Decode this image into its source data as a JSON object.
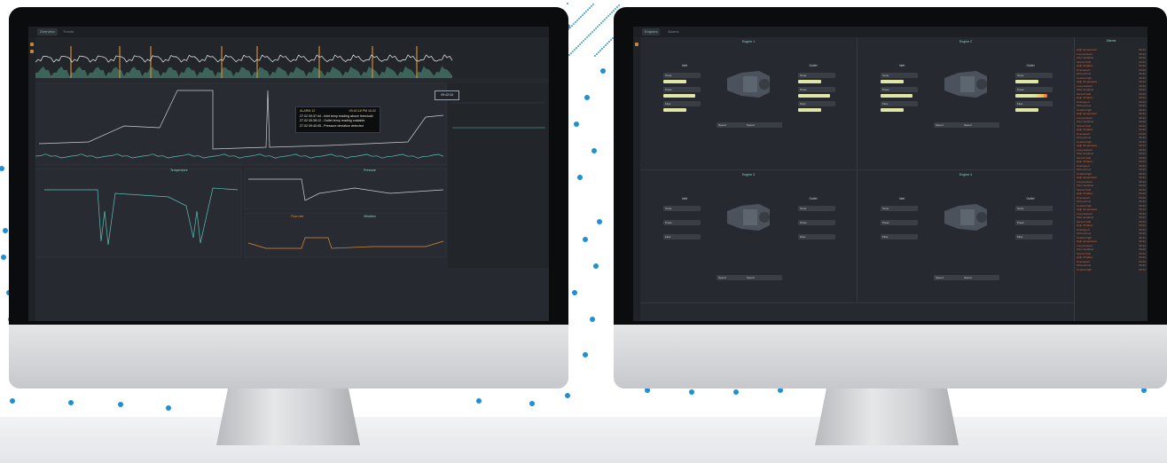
{
  "left_monitor": {
    "tabs": [
      "Overview",
      "Trends"
    ],
    "popup": {
      "title": "ALARM 12",
      "time": "09:42:18 PM 16.02",
      "lines": [
        "27.02 09:37:44 - Inlet temp reading above threshold",
        "27.02 09:38:12 - Outlet temp reading unstable",
        "27.02 09:40:05 - Pressure deviation detected"
      ]
    },
    "cursor_readout": "09:42:18",
    "panel_labels": [
      "Temperature",
      "Pressure",
      "Flow rate",
      "Vibration"
    ]
  },
  "right_monitor": {
    "tabs": [
      "Engines",
      "Alarms"
    ],
    "quad_titles": [
      "Engine 1",
      "Engine 2",
      "Engine 3",
      "Engine 4"
    ],
    "sub_titles": [
      "Inlet",
      "Outlet",
      "Inlet",
      "Outlet"
    ],
    "fields": [
      "Temp",
      "Press",
      "Flow",
      "Speed"
    ],
    "alarm_header": "Alarms",
    "alarms": [
      "High temperature",
      "Low pressure",
      "Flow deviation",
      "Sensor fault",
      "High vibration",
      "Overspeed",
      "Oil level low",
      "Coolant high",
      "High temperature",
      "Low pressure",
      "Flow deviation",
      "Sensor fault",
      "High vibration",
      "Overspeed",
      "Oil level low",
      "Coolant high",
      "High temperature",
      "Low pressure",
      "Flow deviation",
      "Sensor fault",
      "High vibration",
      "Overspeed",
      "Oil level low",
      "Coolant high",
      "High temperature",
      "Low pressure",
      "Flow deviation",
      "Sensor fault",
      "High vibration",
      "Overspeed",
      "Oil level low",
      "Coolant high",
      "High temperature",
      "Low pressure",
      "Flow deviation",
      "Sensor fault",
      "High vibration",
      "Overspeed",
      "Oil level low",
      "Coolant high",
      "High temperature",
      "Low pressure",
      "Flow deviation",
      "Sensor fault",
      "High vibration",
      "Overspeed",
      "Oil level low",
      "Coolant high",
      "High temperature",
      "Low pressure",
      "Flow deviation",
      "Sensor fault",
      "High vibration",
      "Overspeed",
      "Oil level low",
      "Coolant high"
    ],
    "alarm_time": "09:42"
  },
  "colors": {
    "accent_teal": "#8bd4c8",
    "accent_orange": "#e08b38",
    "alarm_red": "#e0653c",
    "gauge_fill": "#dfe6a6",
    "dot_blue": "#1f8fd6"
  }
}
